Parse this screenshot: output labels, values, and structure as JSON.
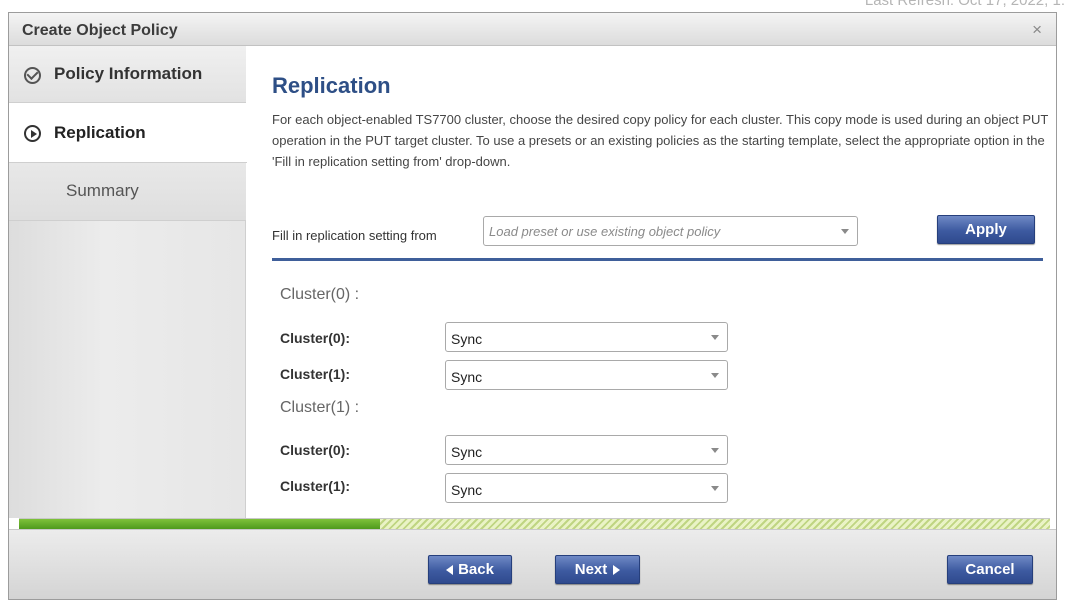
{
  "background": {
    "partial_text": "Last Refresh:  Oct 17, 2022, 1:"
  },
  "dialog": {
    "title": "Create Object Policy",
    "close_symbol": "×"
  },
  "sidebar": {
    "items": [
      {
        "label": "Policy Information",
        "state": "done",
        "icon": "check-circle-icon"
      },
      {
        "label": "Replication",
        "state": "active",
        "icon": "arrow-circle-icon"
      },
      {
        "label": "Summary",
        "state": "pending"
      }
    ]
  },
  "main": {
    "title": "Replication",
    "description": "For each object-enabled TS7700 cluster, choose the desired copy policy for each cluster. This copy mode is used during an object PUT operation in the PUT target cluster. To use a presets or an existing policies as the starting template, select the appropriate option in the 'Fill in replication setting from' drop-down.",
    "fill_label": "Fill in replication setting from",
    "fill_placeholder": "Load preset or use existing object policy",
    "apply_label": "Apply",
    "clusters": [
      {
        "header": "Cluster(0) :",
        "rows": [
          {
            "label": "Cluster(0):",
            "value": "Sync"
          },
          {
            "label": "Cluster(1):",
            "value": "Sync"
          }
        ]
      },
      {
        "header": "Cluster(1) :",
        "rows": [
          {
            "label": "Cluster(0):",
            "value": "Sync"
          },
          {
            "label": "Cluster(1):",
            "value": "Sync"
          }
        ]
      }
    ]
  },
  "progress": {
    "fraction": 0.35
  },
  "footer": {
    "back_label": "Back",
    "next_label": "Next",
    "cancel_label": "Cancel"
  },
  "colors": {
    "accent": "#2e4f86",
    "button": "#3d5aa0",
    "progress": "#5ea82a"
  }
}
